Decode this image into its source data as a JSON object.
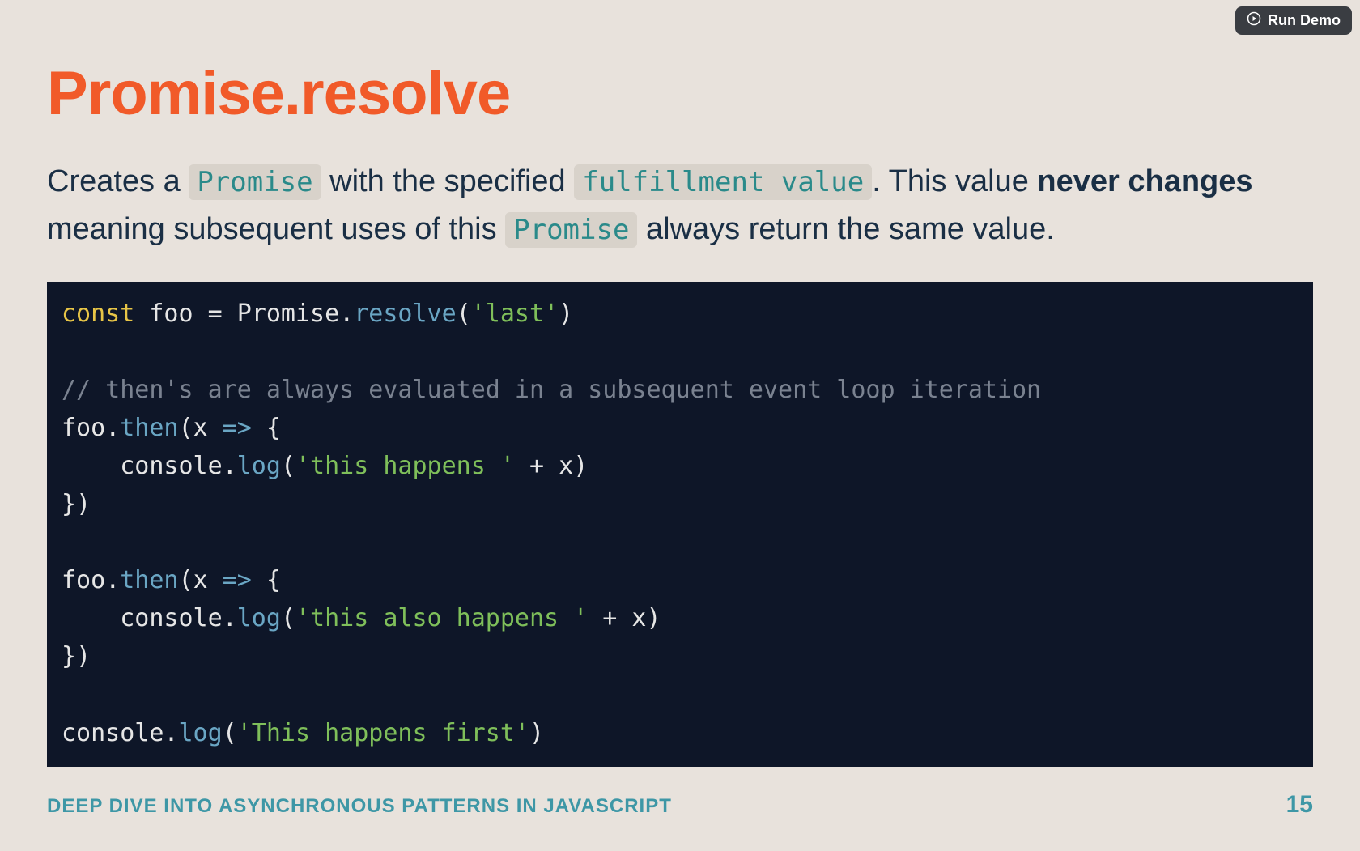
{
  "run_demo": {
    "label": "Run Demo"
  },
  "title": "Promise.resolve",
  "desc": {
    "t1": "Creates a ",
    "pill1": "Promise",
    "t2": " with the specified ",
    "pill2": "fulfillment value",
    "t3": ". This value ",
    "bold1": "never changes",
    "t4": " meaning subsequent uses of this ",
    "pill3": "Promise",
    "t5": " always return the same value."
  },
  "code": {
    "l1": {
      "kw": "const",
      "sp1": " ",
      "id1": "foo",
      "sp2": " ",
      "eq": "=",
      "sp3": " ",
      "id2": "Promise",
      "dot": ".",
      "fn": "resolve",
      "lp": "(",
      "str": "'last'",
      "rp": ")"
    },
    "l2": "",
    "l3": {
      "cmt": "// then's are always evaluated in a subsequent event loop iteration"
    },
    "l4": {
      "id1": "foo",
      "dot": ".",
      "fn": "then",
      "lp": "(",
      "id2": "x",
      "sp": " ",
      "arrow": "=>",
      "sp2": " ",
      "brace": "{"
    },
    "l5": {
      "indent": "    ",
      "id1": "console",
      "dot": ".",
      "fn": "log",
      "lp": "(",
      "str": "'this happens '",
      "sp": " ",
      "plus": "+",
      "sp2": " ",
      "id2": "x",
      "rp": ")"
    },
    "l6": {
      "brace": "}",
      "rp": ")"
    },
    "l7": "",
    "l8": {
      "id1": "foo",
      "dot": ".",
      "fn": "then",
      "lp": "(",
      "id2": "x",
      "sp": " ",
      "arrow": "=>",
      "sp2": " ",
      "brace": "{"
    },
    "l9": {
      "indent": "    ",
      "id1": "console",
      "dot": ".",
      "fn": "log",
      "lp": "(",
      "str": "'this also happens '",
      "sp": " ",
      "plus": "+",
      "sp2": " ",
      "id2": "x",
      "rp": ")"
    },
    "l10": {
      "brace": "}",
      "rp": ")"
    },
    "l11": "",
    "l12": {
      "id1": "console",
      "dot": ".",
      "fn": "log",
      "lp": "(",
      "str": "'This happens first'",
      "rp": ")"
    }
  },
  "footer": {
    "title": "DEEP DIVE INTO ASYNCHRONOUS PATTERNS IN JAVASCRIPT",
    "page": "15"
  }
}
